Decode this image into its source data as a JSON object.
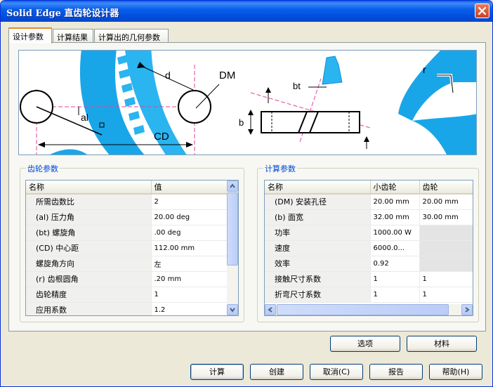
{
  "window": {
    "title": "Solid Edge 直齿轮设计器"
  },
  "tabs": [
    {
      "label": "设计参数"
    },
    {
      "label": "计算结果"
    },
    {
      "label": "计算出的几何参数"
    }
  ],
  "diagram": {
    "labels": {
      "d": "d",
      "dm": "DM",
      "al": "al",
      "cd": "CD",
      "bt": "bt",
      "b": "b",
      "r": "r"
    }
  },
  "gear_params": {
    "title": "齿轮参数",
    "headers": [
      "名称",
      "值"
    ],
    "rows": [
      {
        "name": "所需齿数比",
        "value": "2"
      },
      {
        "name": "(al) 压力角",
        "value": "20.00 deg"
      },
      {
        "name": "(bt) 螺旋角",
        "value": ".00 deg"
      },
      {
        "name": "(CD) 中心距",
        "value": "112.00 mm"
      },
      {
        "name": "螺旋角方向",
        "value": "左"
      },
      {
        "name": "(r) 齿根圆角",
        "value": ".20 mm"
      },
      {
        "name": "齿轮精度",
        "value": "1"
      },
      {
        "name": "应用系数",
        "value": "1.2"
      }
    ]
  },
  "calc_params": {
    "title": "计算参数",
    "headers": [
      "名称",
      "小齿轮",
      "齿轮"
    ],
    "rows": [
      {
        "name": "(DM) 安装孔径",
        "pinion": "20.00 mm",
        "gear": "20.00 mm"
      },
      {
        "name": "(b) 面宽",
        "pinion": "32.00 mm",
        "gear": "30.00 mm"
      },
      {
        "name": "功率",
        "pinion": "1000.00 W",
        "gear": ""
      },
      {
        "name": "速度",
        "pinion": "6000.0...",
        "gear": ""
      },
      {
        "name": "效率",
        "pinion": "0.92",
        "gear": ""
      },
      {
        "name": "接触尺寸系数",
        "pinion": "1",
        "gear": "1"
      },
      {
        "name": "折弯尺寸系数",
        "pinion": "1",
        "gear": "1"
      }
    ]
  },
  "panel_buttons": {
    "options": "选项",
    "material": "材料"
  },
  "footer_buttons": {
    "calculate": "计算",
    "create": "创建",
    "cancel": "取消(C)",
    "report": "报告",
    "help": "帮助(H)"
  }
}
